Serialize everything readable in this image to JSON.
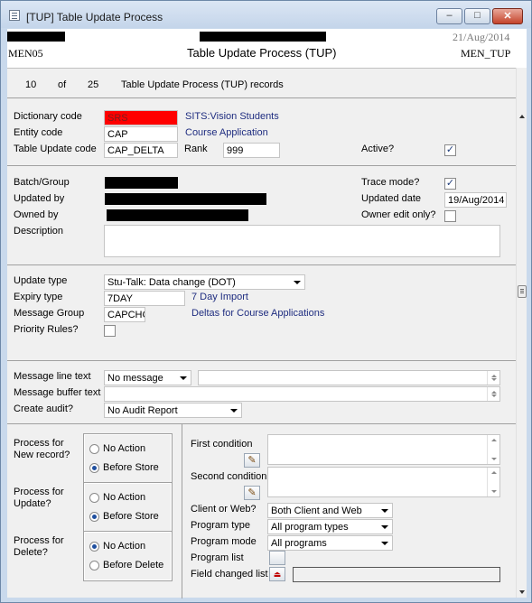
{
  "window": {
    "title": "[TUP] Table Update Process",
    "minimize": "–",
    "maximize": "□",
    "close": "✕"
  },
  "header": {
    "left_code": "MEN05",
    "center_title": "Table Update Process (TUP)",
    "right_code": "MEN_TUP",
    "date": "21/Aug/2014"
  },
  "records": {
    "current": "10",
    "of_label": "of",
    "total": "25",
    "description": "Table Update Process (TUP) records"
  },
  "section1": {
    "dictionary_code_label": "Dictionary code",
    "dictionary_code_value": "SRS",
    "dictionary_code_desc": "SITS:Vision Students",
    "entity_code_label": "Entity code",
    "entity_code_value": "CAP",
    "entity_code_desc": "Course Application",
    "table_update_code_label": "Table Update code",
    "table_update_code_value": "CAP_DELTA",
    "rank_label": "Rank",
    "rank_value": "999",
    "active_label": "Active?",
    "active_checked": "✓"
  },
  "section2": {
    "batch_group_label": "Batch/Group",
    "updated_by_label": "Updated by",
    "owned_by_label": "Owned by",
    "description_label": "Description",
    "trace_mode_label": "Trace mode?",
    "trace_mode_checked": "✓",
    "updated_date_label": "Updated date",
    "updated_date_value": "19/Aug/2014",
    "owner_edit_only_label": "Owner edit only?"
  },
  "section3": {
    "update_type_label": "Update type",
    "update_type_value": "Stu-Talk: Data change (DOT)",
    "expiry_type_label": "Expiry type",
    "expiry_type_value": "7DAY",
    "expiry_type_desc": "7 Day Import",
    "message_group_label": "Message Group",
    "message_group_value": "CAPCHG",
    "message_group_desc": "Deltas for Course Applications",
    "priority_rules_label": "Priority Rules?"
  },
  "section4": {
    "message_line_text_label": "Message line text",
    "message_line_text_value": "No message",
    "message_buffer_text_label": "Message buffer text",
    "create_audit_label": "Create audit?",
    "create_audit_value": "No Audit Report"
  },
  "section5": {
    "process_new_label_1": "Process for",
    "process_new_label_2": "New record?",
    "process_update_label_1": "Process for",
    "process_update_label_2": "Update?",
    "process_delete_label_1": "Process for",
    "process_delete_label_2": "Delete?",
    "new_opt_no_action": "No Action",
    "new_opt_before_store": "Before Store",
    "update_opt_no_action": "No Action",
    "update_opt_before_store": "Before Store",
    "delete_opt_no_action": "No Action",
    "delete_opt_before_delete": "Before Delete",
    "first_condition_label": "First condition",
    "second_condition_label": "Second condition",
    "client_or_web_label": "Client or Web?",
    "client_or_web_value": "Both Client and Web",
    "program_type_label": "Program type",
    "program_type_value": "All program types",
    "program_mode_label": "Program mode",
    "program_mode_value": "All programs",
    "program_list_label": "Program list",
    "field_changed_list_label": "Field changed list"
  },
  "colors": {
    "dictionary_code_bg": "#ff0000",
    "link_text": "#1f2d80"
  }
}
